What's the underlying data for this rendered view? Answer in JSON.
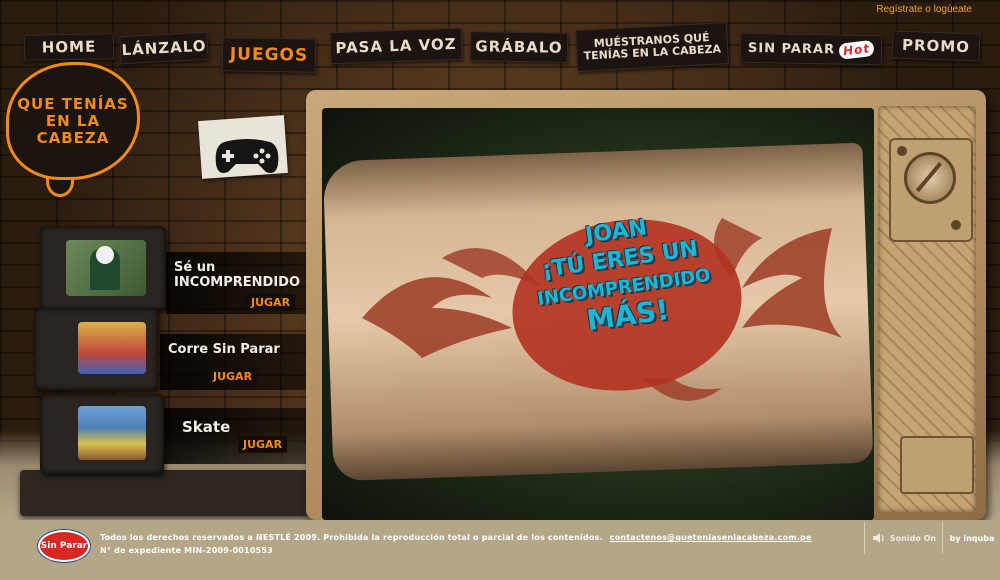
{
  "top": {
    "register_link": "Regístrate o logúeate"
  },
  "nav": {
    "home": "HOME",
    "lanzalo": "LÁNZALO",
    "juegos": "JUEGOS",
    "pasa_la_voz": "PASA LA VOZ",
    "grabalo": "GRÁBALO",
    "muestranos_line1": "MUÉSTRANOS QUÉ",
    "muestranos_line2": "TENÍAS EN LA CABEZA",
    "sin_parar": "SIN PARAR",
    "hot": "Hot",
    "promo": "PROMO"
  },
  "logo": {
    "text": "QUE TENÍAS EN LA CABEZA"
  },
  "games": [
    {
      "title_line1": "Sé un",
      "title_line2": "INCOMPRENDIDO",
      "play": "JUGAR"
    },
    {
      "title_line1": "Corre Sin Parar",
      "title_line2": "",
      "play": "JUGAR"
    },
    {
      "title_line1": "Skate",
      "title_line2": "",
      "play": "JUGAR"
    }
  ],
  "result": {
    "name": "JOAN",
    "line1": "¡TÚ ERES UN",
    "line2": "INCOMPRENDIDO",
    "line3": "MÁS!"
  },
  "footer": {
    "logo_text": "Sin Parar",
    "copyright": "Todos los derechos reservados a NESTLÉ 2009. Prohibida la reproducción total o parcial de los contenidos.",
    "contact_email": "contactenos@queteniasenlacabeza.com.pe",
    "expediente": "N° de expediente MIN-2009-0010553",
    "sound_label": "Sonido On",
    "credit": "by inquba"
  },
  "colors": {
    "accent": "#f38a1a",
    "footer": "#b5a688",
    "wall": "#5e3d22",
    "result_text": "#1fb6d6",
    "tattoo": "#b33220"
  }
}
